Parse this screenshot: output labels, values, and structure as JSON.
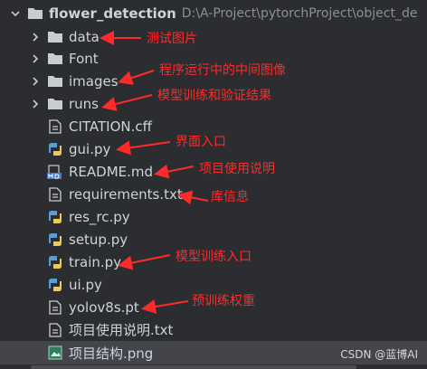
{
  "root": {
    "name": "flower_detection",
    "path": "D:\\A-Project\\pytorchProject\\object_de"
  },
  "items": [
    {
      "label": "data",
      "kind": "folder"
    },
    {
      "label": "Font",
      "kind": "folder"
    },
    {
      "label": "images",
      "kind": "folder"
    },
    {
      "label": "runs",
      "kind": "folder"
    },
    {
      "label": "CITATION.cff",
      "kind": "text-file"
    },
    {
      "label": "gui.py",
      "kind": "python-file"
    },
    {
      "label": "README.md",
      "kind": "markdown-file"
    },
    {
      "label": "requirements.txt",
      "kind": "text-file"
    },
    {
      "label": "res_rc.py",
      "kind": "python-file"
    },
    {
      "label": "setup.py",
      "kind": "python-file"
    },
    {
      "label": "train.py",
      "kind": "python-file"
    },
    {
      "label": "ui.py",
      "kind": "python-file"
    },
    {
      "label": "yolov8s.pt",
      "kind": "text-file"
    },
    {
      "label": "项目使用说明.txt",
      "kind": "text-file"
    },
    {
      "label": "项目结构.png",
      "kind": "image-file"
    }
  ],
  "annotations": {
    "data": "测试图片",
    "images": "程序运行中的中间图像",
    "runs": "模型训练和验证结果",
    "gui": "界面入口",
    "readme": "项目使用说明",
    "requirements": "库信息",
    "train": "模型训练入口",
    "yolov8s": "预训练权重"
  },
  "watermark": "CSDN @蓝博AI",
  "colors": {
    "annotation": "#ff2a2a",
    "background": "#2b2d30",
    "selected_row": "#43454a"
  }
}
